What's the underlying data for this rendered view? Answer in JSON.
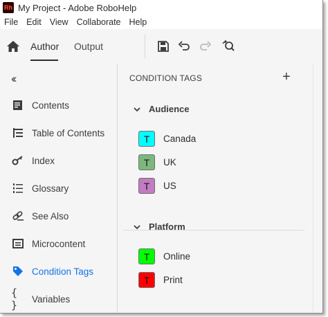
{
  "window": {
    "app_icon_text": "Rh",
    "title": "My Project - Adobe RoboHelp"
  },
  "menu": [
    "File",
    "Edit",
    "View",
    "Collaborate",
    "Help"
  ],
  "toolbar": {
    "tabs": {
      "author": "Author",
      "output": "Output"
    },
    "buttons": [
      "save-icon",
      "undo-icon",
      "redo-icon",
      "find-replace-icon"
    ]
  },
  "sidebar": {
    "collapse_icon": "double-chevron-left-icon",
    "items": [
      {
        "label": "Contents",
        "icon": "contents-icon"
      },
      {
        "label": "Table of Contents",
        "icon": "toc-icon"
      },
      {
        "label": "Index",
        "icon": "key-icon"
      },
      {
        "label": "Glossary",
        "icon": "glossary-icon"
      },
      {
        "label": "See Also",
        "icon": "link-icon"
      },
      {
        "label": "Microcontent",
        "icon": "microcontent-icon"
      },
      {
        "label": "Condition Tags",
        "icon": "tag-icon",
        "active": true
      },
      {
        "label": "Variables",
        "icon": "braces-icon"
      }
    ]
  },
  "panel": {
    "title": "CONDITION TAGS",
    "add_icon": "plus-icon",
    "groups": [
      {
        "name": "Audience",
        "tags": [
          {
            "letter": "T",
            "label": "Canada",
            "color": "#00ffff"
          },
          {
            "letter": "T",
            "label": "UK",
            "color": "#7cb87c"
          },
          {
            "letter": "T",
            "label": "US",
            "color": "#c27cc2"
          }
        ]
      },
      {
        "name": "Platform",
        "tags": [
          {
            "letter": "T",
            "label": "Online",
            "color": "#00ff00"
          },
          {
            "letter": "T",
            "label": "Print",
            "color": "#ff0000"
          }
        ]
      }
    ]
  },
  "colors": {
    "accent": "#1473e6",
    "background": "#f5f5f5"
  }
}
